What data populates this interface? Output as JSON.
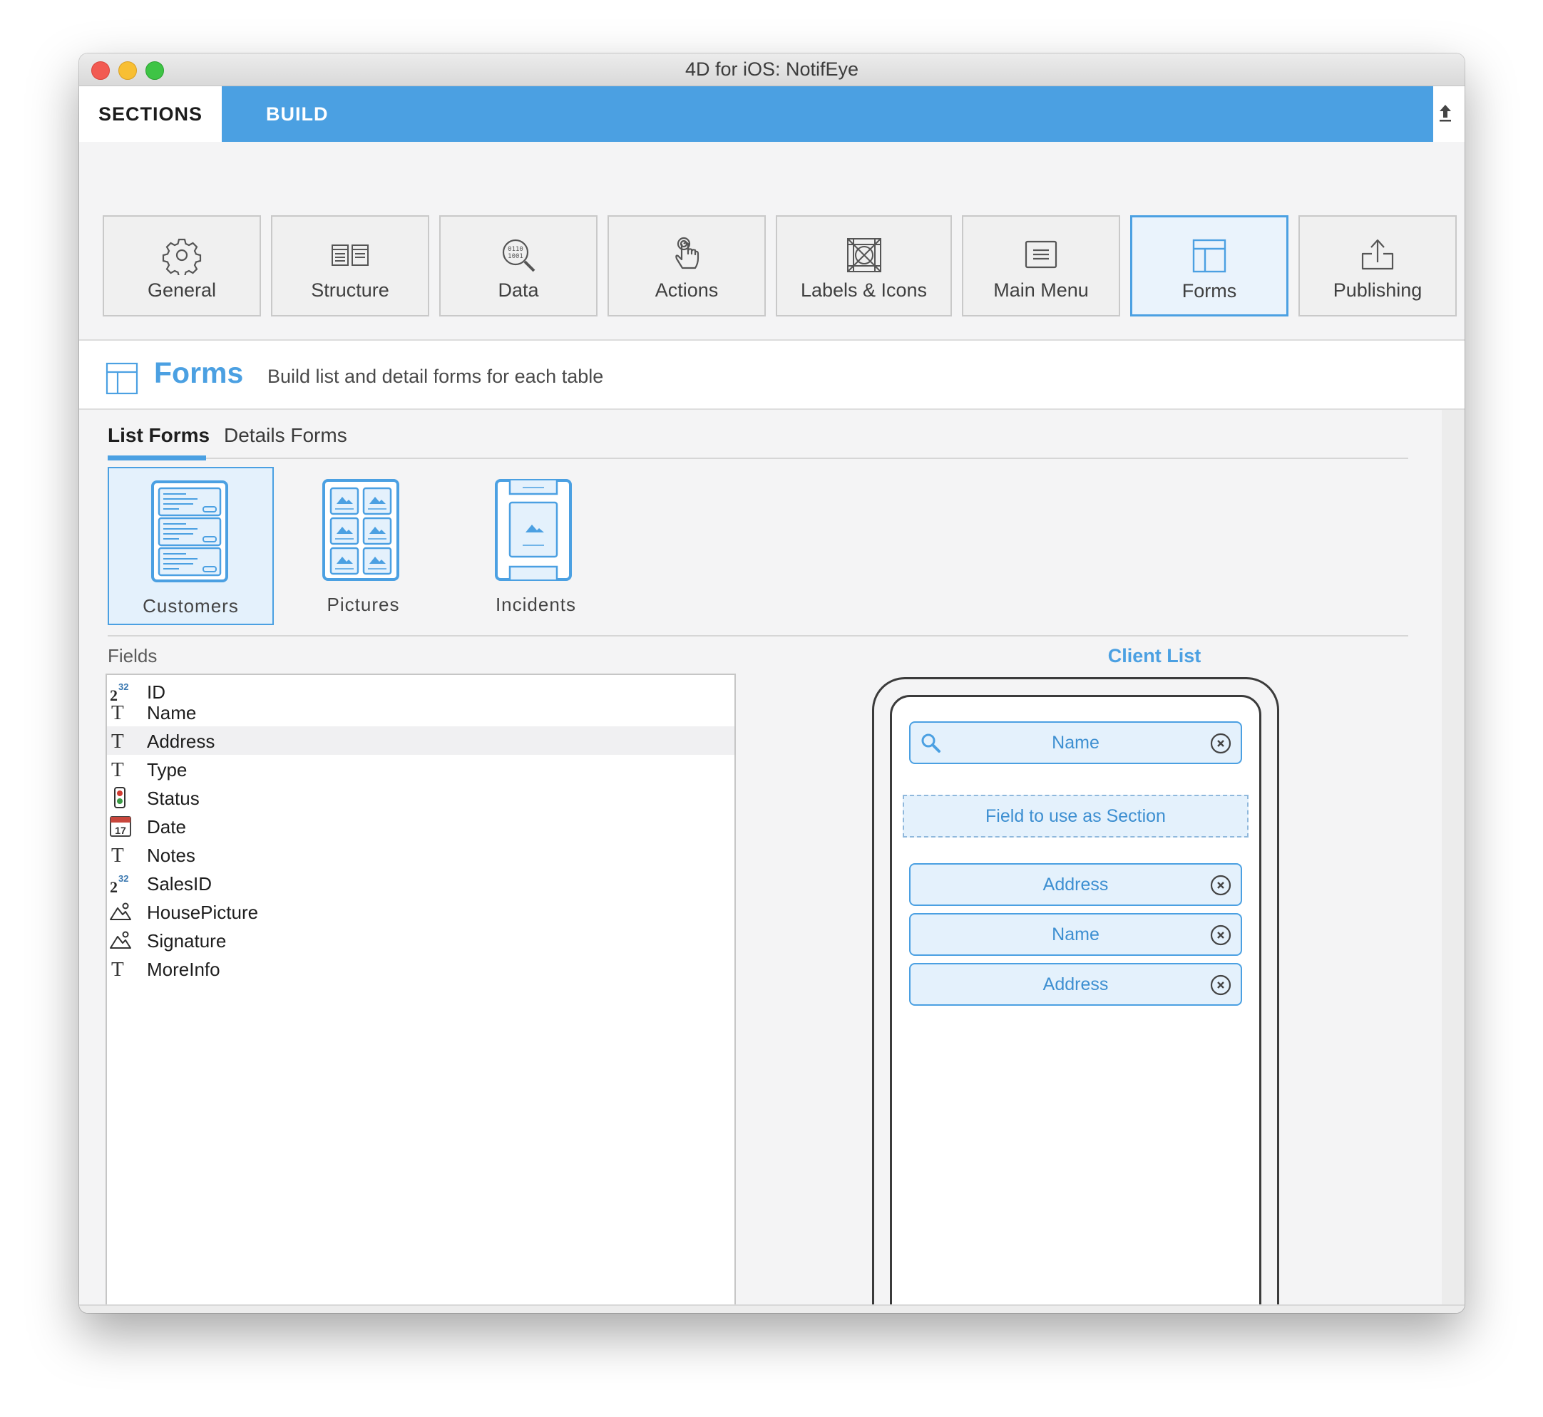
{
  "window": {
    "title": "4D for iOS: NotifEye"
  },
  "tabs": {
    "sections": "SECTIONS",
    "build": "BUILD"
  },
  "toolbar": {
    "items": [
      {
        "label": "General",
        "icon": "gear-icon"
      },
      {
        "label": "Structure",
        "icon": "structure-icon"
      },
      {
        "label": "Data",
        "icon": "data-icon"
      },
      {
        "label": "Actions",
        "icon": "touch-icon"
      },
      {
        "label": "Labels & Icons",
        "icon": "labels-icon"
      },
      {
        "label": "Main Menu",
        "icon": "menu-icon"
      },
      {
        "label": "Forms",
        "icon": "forms-icon",
        "active": true
      },
      {
        "label": "Publishing",
        "icon": "upload-icon"
      }
    ]
  },
  "header": {
    "title": "Forms",
    "subtitle": "Build list and detail forms for each table"
  },
  "subtabs": {
    "list": "List Forms",
    "details": "Details Forms"
  },
  "templates": [
    {
      "label": "Customers",
      "selected": true
    },
    {
      "label": "Pictures"
    },
    {
      "label": "Incidents"
    }
  ],
  "fields": {
    "label": "Fields",
    "items": [
      {
        "name": "ID",
        "type": "integer"
      },
      {
        "name": "Name",
        "type": "text"
      },
      {
        "name": "Address",
        "type": "text"
      },
      {
        "name": "Type",
        "type": "text"
      },
      {
        "name": "Status",
        "type": "boolean"
      },
      {
        "name": "Date",
        "type": "date"
      },
      {
        "name": "Notes",
        "type": "text"
      },
      {
        "name": "SalesID",
        "type": "integer"
      },
      {
        "name": "HousePicture",
        "type": "picture"
      },
      {
        "name": "Signature",
        "type": "picture"
      },
      {
        "name": "MoreInfo",
        "type": "text"
      }
    ],
    "integer_glyph": {
      "base": "2",
      "exp": "32"
    },
    "text_glyph": "T",
    "date_glyph": "17"
  },
  "preview": {
    "title": "Client List",
    "search_field": "Name",
    "section_placeholder": "Field to use as Section",
    "slots": [
      "Address",
      "Name",
      "Address"
    ]
  },
  "colors": {
    "accent": "#4ba0e2",
    "accent_light": "#e4f1fc"
  }
}
